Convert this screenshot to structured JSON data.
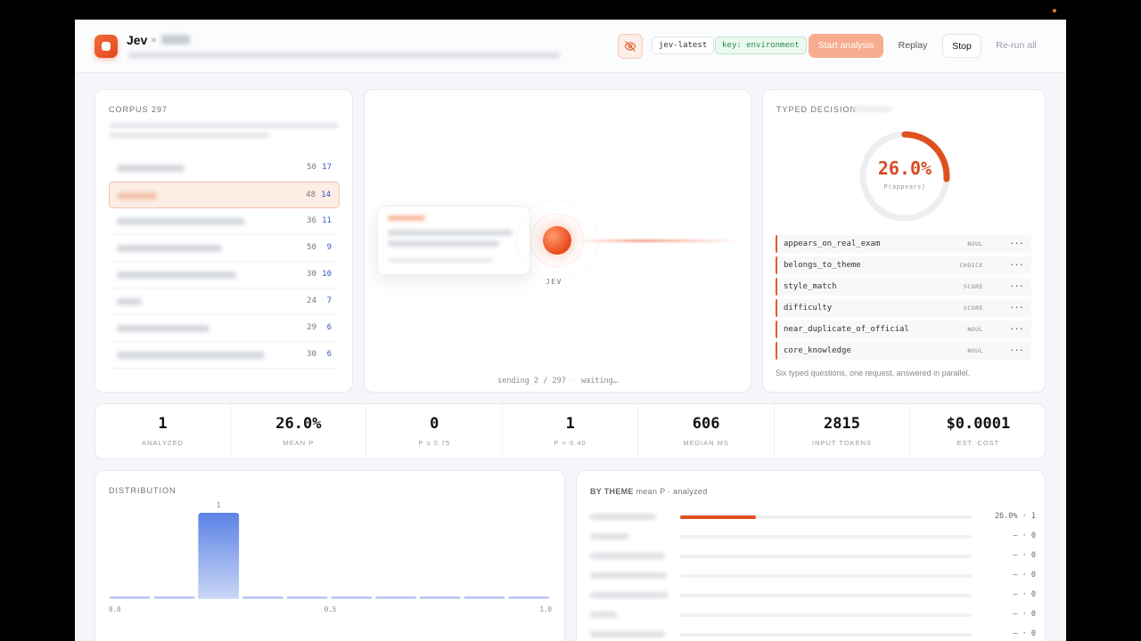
{
  "header": {
    "app_name": "Jev",
    "title_sep": "×",
    "model_chip": "jev-latest",
    "key_chip": "key: environment",
    "start_label": "Start analysis",
    "replay_label": "Replay",
    "stop_label": "Stop",
    "rerun_label": "Re-run all"
  },
  "corpus": {
    "label": "CORPUS 297",
    "rows": [
      {
        "n": "50",
        "m": "17",
        "w": 76,
        "selected": false
      },
      {
        "n": "48",
        "m": "14",
        "w": 44,
        "selected": true
      },
      {
        "n": "36",
        "m": "11",
        "w": 144,
        "selected": false
      },
      {
        "n": "50",
        "m": "9",
        "w": 118,
        "selected": false
      },
      {
        "n": "30",
        "m": "10",
        "w": 134,
        "selected": false
      },
      {
        "n": "24",
        "m": "7",
        "w": 28,
        "selected": false
      },
      {
        "n": "29",
        "m": "6",
        "w": 104,
        "selected": false
      },
      {
        "n": "30",
        "m": "6",
        "w": 166,
        "selected": false
      }
    ]
  },
  "center": {
    "orb_label": "JEV",
    "sending": "sending 2 / 297",
    "separator": "·",
    "waiting": "waiting…"
  },
  "typed": {
    "label": "TYPED DECISION",
    "gauge_value": "26.0%",
    "gauge_fraction": 0.26,
    "gauge_sub": "P(appears)",
    "questions": [
      {
        "name": "appears_on_real_exam",
        "type": "NOUL"
      },
      {
        "name": "belongs_to_theme",
        "type": "CHOICE"
      },
      {
        "name": "style_match",
        "type": "SCORE"
      },
      {
        "name": "difficulty",
        "type": "SCORE"
      },
      {
        "name": "near_duplicate_of_official",
        "type": "NOUL"
      },
      {
        "name": "core_knowledge",
        "type": "NOUL"
      }
    ],
    "more_glyph": "···",
    "footer": "Six typed questions, one request, answered in parallel."
  },
  "stats": [
    {
      "value": "1",
      "label": "ANALYZED"
    },
    {
      "value": "26.0%",
      "label": "MEAN P"
    },
    {
      "value": "0",
      "label": "P ≥ 0.75"
    },
    {
      "value": "1",
      "label": "P < 0.40"
    },
    {
      "value": "606",
      "label": "MEDIAN MS"
    },
    {
      "value": "2815",
      "label": "INPUT TOKENS"
    },
    {
      "value": "$0.0001",
      "label": "EST. COST"
    }
  ],
  "distribution": {
    "label": "DISTRIBUTION"
  },
  "chart_data": {
    "type": "bar",
    "categories": [
      "0.0-0.1",
      "0.1-0.2",
      "0.2-0.3",
      "0.3-0.4",
      "0.4-0.5",
      "0.5-0.6",
      "0.6-0.7",
      "0.7-0.8",
      "0.8-0.9",
      "0.9-1.0"
    ],
    "values": [
      0,
      0,
      1,
      0,
      0,
      0,
      0,
      0,
      0,
      0
    ],
    "x_ticks": [
      "0.0",
      "0.5",
      "1.0"
    ],
    "xlim": [
      0,
      1
    ],
    "ylim": [
      0,
      1
    ]
  },
  "theme": {
    "title_bold": "BY THEME",
    "title_rest": "mean P · analyzed",
    "rows": [
      {
        "value": "26.0% · 1",
        "fill": 0.26,
        "w": 74
      },
      {
        "value": "— · 0",
        "fill": 0,
        "w": 44
      },
      {
        "value": "— · 0",
        "fill": 0,
        "w": 84
      },
      {
        "value": "— · 0",
        "fill": 0,
        "w": 86
      },
      {
        "value": "— · 0",
        "fill": 0,
        "w": 88
      },
      {
        "value": "— · 0",
        "fill": 0,
        "w": 30
      },
      {
        "value": "— · 0",
        "fill": 0,
        "w": 84
      }
    ]
  },
  "colors": {
    "accent": "#e0501f",
    "bar": "#5b82e6",
    "link": "#3556c9"
  }
}
